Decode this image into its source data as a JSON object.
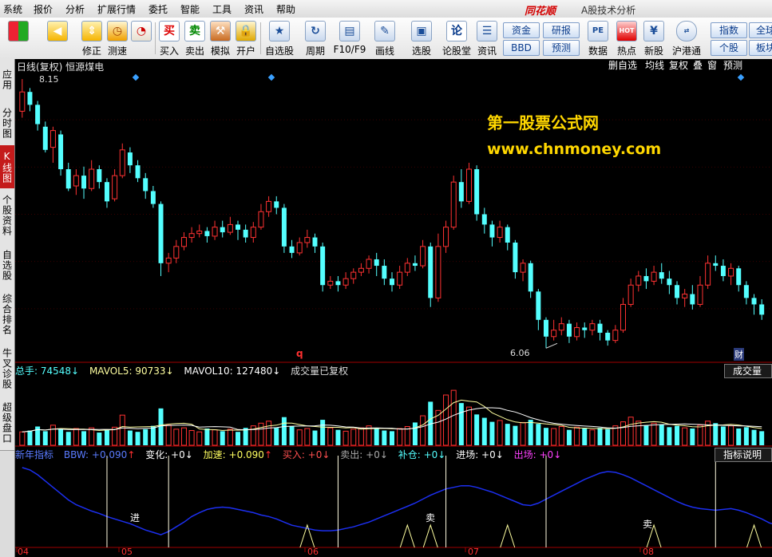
{
  "menu": {
    "items": [
      "系统",
      "报价",
      "分析",
      "扩展行情",
      "委托",
      "智能",
      "工具",
      "资讯",
      "帮助"
    ],
    "brand": "同花顺",
    "app_title": "A股技术分析"
  },
  "toolbar": {
    "buttons": [
      {
        "label": "",
        "icon": "windows-logo-icon"
      },
      {
        "label": "",
        "icon": "back-arrow-icon"
      },
      {
        "label": "修正",
        "icon": "up-down-arrow-icon"
      },
      {
        "label": "测速",
        "icon": "clock-icon"
      },
      {
        "label": "买入",
        "icon": "buy-icon",
        "glyph": "买"
      },
      {
        "label": "卖出",
        "icon": "sell-icon",
        "glyph": "卖"
      },
      {
        "label": "模拟",
        "icon": "gavel-icon"
      },
      {
        "label": "开户",
        "icon": "lock-icon"
      },
      {
        "label": "自选股",
        "icon": "star-icon"
      },
      {
        "label": "周期",
        "icon": "cycle-icon"
      },
      {
        "label": "F10/F9",
        "icon": "f10-icon"
      },
      {
        "label": "画线",
        "icon": "pen-icon"
      },
      {
        "label": "选股",
        "icon": "select-stock-icon"
      },
      {
        "label": "论股堂",
        "icon": "forum-icon",
        "glyph": "论"
      },
      {
        "label": "资讯",
        "icon": "news-icon"
      },
      {
        "label": "数据",
        "icon": "pe-icon",
        "glyph": "PE"
      },
      {
        "label": "热点",
        "icon": "hot-icon",
        "glyph": "HOT"
      },
      {
        "label": "新股",
        "icon": "ipo-icon"
      },
      {
        "label": "沪港通",
        "icon": "sse-hkex-icon"
      }
    ],
    "pills": [
      "资金",
      "研报",
      "BBD",
      "预测",
      "指数",
      "全球",
      "个股",
      "板块"
    ]
  },
  "left_tabs": [
    {
      "label": "应用",
      "active": false
    },
    {
      "label": "分时图",
      "active": false
    },
    {
      "label": "K线图",
      "active": true
    },
    {
      "label": "个股资料",
      "active": false
    },
    {
      "label": "自选股",
      "active": false
    },
    {
      "label": "综合排名",
      "active": false
    },
    {
      "label": "牛叉诊股",
      "active": false
    },
    {
      "label": "超级盘口",
      "active": false
    }
  ],
  "chart_header": {
    "stock": "日线(复权)  恒源煤电",
    "buttons": [
      "删自选",
      "均线",
      "复权",
      "叠",
      "窗",
      "预测"
    ]
  },
  "watermark": {
    "line1": "第一股票公式网",
    "line2": "www.chnmoney.com"
  },
  "price": {
    "high_label": "8.15",
    "low_label": "6.06",
    "event_q": "q",
    "event_cai": "财"
  },
  "volume_bar": {
    "total": "总手: 74548",
    "mavol5": "MAVOL5: 90733",
    "mavol10": "MAVOL10: 127480",
    "note": "成交量已复权",
    "button": "成交量"
  },
  "indicator_bar": {
    "name": "新年指标",
    "bbw": "BBW: +0.090",
    "change": "变化: +0",
    "accel": "加速: +0.090",
    "buy": "买入: +0",
    "sell": "卖出: +0",
    "add": "补仓: +0",
    "enter": "进场: +0",
    "exit": "出场: +0",
    "button": "指标说明",
    "signal_enter": "进",
    "signal_sell1": "卖",
    "signal_sell2": "卖"
  },
  "x_axis": [
    "04",
    "05",
    "06",
    "07",
    "08"
  ],
  "colors": {
    "up": "#ff3232",
    "down": "#54ffff",
    "ma5": "#ffffa0",
    "ma10": "#ffffff",
    "bbw_line": "#1c2ff0",
    "axis": "#a00000",
    "brand": "#d40000"
  },
  "chart_data": {
    "type": "candlestick",
    "price_range": [
      6.0,
      8.2
    ],
    "high": 8.15,
    "low": 6.06,
    "candles": [
      [
        7.9,
        8.05,
        8.15,
        7.85
      ],
      [
        8.05,
        7.95,
        8.08,
        7.9
      ],
      [
        7.95,
        7.8,
        7.98,
        7.75
      ],
      [
        7.78,
        7.6,
        7.82,
        7.58
      ],
      [
        7.62,
        7.75,
        7.78,
        7.5
      ],
      [
        7.72,
        7.45,
        7.75,
        7.4
      ],
      [
        7.45,
        7.3,
        7.5,
        7.28
      ],
      [
        7.32,
        7.4,
        7.45,
        7.25
      ],
      [
        7.4,
        7.3,
        7.47,
        7.22
      ],
      [
        7.3,
        7.45,
        7.52,
        7.28
      ],
      [
        7.45,
        7.35,
        7.48,
        7.3
      ],
      [
        7.35,
        7.2,
        7.38,
        7.15
      ],
      [
        7.22,
        7.4,
        7.45,
        7.2
      ],
      [
        7.4,
        7.6,
        7.65,
        7.38
      ],
      [
        7.58,
        7.48,
        7.62,
        7.42
      ],
      [
        7.48,
        7.38,
        7.52,
        7.35
      ],
      [
        7.38,
        7.28,
        7.42,
        7.22
      ],
      [
        7.28,
        7.18,
        7.32,
        7.15
      ],
      [
        7.18,
        6.72,
        7.2,
        6.62
      ],
      [
        6.72,
        6.76,
        6.8,
        6.65
      ],
      [
        6.76,
        6.85,
        6.9,
        6.72
      ],
      [
        6.85,
        6.92,
        6.96,
        6.82
      ],
      [
        6.92,
        6.95,
        7.0,
        6.88
      ],
      [
        6.95,
        6.97,
        7.02,
        6.92
      ],
      [
        6.97,
        6.93,
        7.0,
        6.88
      ],
      [
        6.93,
        7.0,
        7.05,
        6.9
      ],
      [
        7.0,
        6.96,
        7.05,
        6.92
      ],
      [
        6.96,
        7.02,
        7.08,
        6.94
      ],
      [
        7.02,
        6.98,
        7.05,
        6.9
      ],
      [
        6.98,
        6.92,
        7.02,
        6.88
      ],
      [
        6.92,
        7.0,
        7.04,
        6.88
      ],
      [
        7.0,
        7.12,
        7.18,
        6.98
      ],
      [
        7.12,
        7.2,
        7.24,
        7.08
      ],
      [
        7.2,
        7.15,
        7.24,
        7.1
      ],
      [
        7.15,
        6.85,
        7.18,
        6.8
      ],
      [
        6.85,
        6.8,
        6.9,
        6.76
      ],
      [
        6.8,
        6.88,
        6.92,
        6.78
      ],
      [
        6.88,
        6.92,
        6.98,
        6.84
      ],
      [
        6.92,
        6.85,
        6.95,
        6.8
      ],
      [
        6.85,
        6.55,
        6.88,
        6.5
      ],
      [
        6.55,
        6.58,
        6.62,
        6.52
      ],
      [
        6.58,
        6.55,
        6.62,
        6.5
      ],
      [
        6.55,
        6.6,
        6.65,
        6.52
      ],
      [
        6.6,
        6.65,
        6.68,
        6.56
      ],
      [
        6.65,
        6.68,
        6.72,
        6.62
      ],
      [
        6.68,
        6.75,
        6.78,
        6.64
      ],
      [
        6.75,
        6.7,
        6.8,
        6.62
      ],
      [
        6.7,
        6.6,
        6.75,
        6.55
      ],
      [
        6.6,
        6.55,
        6.65,
        6.5
      ],
      [
        6.55,
        6.65,
        6.7,
        6.52
      ],
      [
        6.65,
        6.72,
        6.76,
        6.62
      ],
      [
        6.72,
        6.7,
        6.78,
        6.66
      ],
      [
        6.7,
        6.85,
        6.9,
        6.68
      ],
      [
        6.85,
        6.45,
        6.88,
        6.38
      ],
      [
        6.45,
        6.85,
        6.95,
        6.42
      ],
      [
        6.85,
        7.0,
        7.05,
        6.8
      ],
      [
        7.0,
        7.35,
        7.4,
        6.98
      ],
      [
        7.35,
        7.2,
        7.45,
        7.15
      ],
      [
        7.2,
        7.45,
        7.5,
        7.18
      ],
      [
        7.45,
        7.1,
        7.48,
        7.05
      ],
      [
        7.1,
        7.02,
        7.15,
        6.95
      ],
      [
        7.02,
        6.92,
        7.05,
        6.85
      ],
      [
        6.92,
        7.0,
        7.05,
        6.88
      ],
      [
        7.0,
        6.88,
        7.02,
        6.82
      ],
      [
        6.88,
        6.65,
        6.9,
        6.6
      ],
      [
        6.65,
        6.72,
        6.75,
        6.58
      ],
      [
        6.72,
        6.5,
        6.74,
        6.45
      ],
      [
        6.5,
        6.28,
        6.52,
        6.2
      ],
      [
        6.28,
        6.15,
        6.3,
        6.06
      ],
      [
        6.15,
        6.2,
        6.28,
        6.12
      ],
      [
        6.2,
        6.25,
        6.3,
        6.16
      ],
      [
        6.25,
        6.15,
        6.28,
        6.1
      ],
      [
        6.15,
        6.22,
        6.26,
        6.12
      ],
      [
        6.22,
        6.2,
        6.26,
        6.14
      ],
      [
        6.2,
        6.25,
        6.28,
        6.16
      ],
      [
        6.25,
        6.18,
        6.28,
        6.12
      ],
      [
        6.18,
        6.12,
        6.2,
        6.08
      ],
      [
        6.12,
        6.2,
        6.24,
        6.1
      ],
      [
        6.2,
        6.4,
        6.45,
        6.18
      ],
      [
        6.4,
        6.55,
        6.6,
        6.38
      ],
      [
        6.55,
        6.62,
        6.66,
        6.5
      ],
      [
        6.62,
        6.58,
        6.68,
        6.52
      ],
      [
        6.58,
        6.65,
        6.7,
        6.55
      ],
      [
        6.65,
        6.6,
        6.72,
        6.56
      ],
      [
        6.6,
        6.55,
        6.66,
        6.48
      ],
      [
        6.55,
        6.45,
        6.58,
        6.4
      ],
      [
        6.45,
        6.48,
        6.52,
        6.38
      ],
      [
        6.48,
        6.4,
        6.55,
        6.36
      ],
      [
        6.4,
        6.55,
        6.62,
        6.38
      ],
      [
        6.55,
        6.72,
        6.78,
        6.52
      ],
      [
        6.72,
        6.7,
        6.78,
        6.66
      ],
      [
        6.7,
        6.62,
        6.75,
        6.58
      ],
      [
        6.62,
        6.68,
        6.72,
        6.55
      ],
      [
        6.68,
        6.55,
        6.7,
        6.5
      ],
      [
        6.55,
        6.45,
        6.58,
        6.4
      ],
      [
        6.45,
        6.4,
        6.48,
        6.32
      ],
      [
        6.4,
        6.32,
        6.44,
        6.28
      ]
    ],
    "volume": [
      2,
      2.2,
      2.8,
      2.1,
      3,
      2.4,
      2,
      2.5,
      2.1,
      2.6,
      1.9,
      2.3,
      2.7,
      4.5,
      2.2,
      2,
      2.4,
      2.9,
      5.5,
      3,
      2.4,
      2.6,
      2.2,
      2,
      2.5,
      2.3,
      2.1,
      2.4,
      2,
      2.6,
      2.9,
      3.3,
      3.6,
      2.6,
      4.2,
      2.8,
      2.3,
      2.5,
      2.2,
      3.8,
      2.6,
      2.3,
      2.1,
      2.4,
      2.6,
      2.9,
      2.5,
      2.2,
      2.1,
      2.5,
      2.8,
      3.4,
      4.4,
      6.5,
      5.2,
      7.5,
      8.2,
      6.3,
      5.7,
      4.6,
      4.1,
      3.5,
      3.7,
      3.2,
      2.9,
      3.4,
      3.8,
      3.2,
      2.6,
      2.5,
      2.8,
      2.3,
      2.7,
      2.5,
      2.3,
      2.6,
      2.4,
      2.9,
      3.5,
      4.2,
      3.6,
      3.0,
      3.3,
      3.1,
      2.7,
      2.9,
      2.6,
      2.5,
      3.0,
      3.6,
      3.3,
      2.8,
      2.9,
      2.5,
      2.7,
      2.3,
      2.1
    ],
    "volume_range": [
      0,
      10
    ],
    "bbw_line": [
      0.95,
      0.92,
      0.86,
      0.78,
      0.7,
      0.62,
      0.54,
      0.48,
      0.44,
      0.4,
      0.37,
      0.33,
      0.3,
      0.27,
      0.24,
      0.2,
      0.16,
      0.13,
      0.1,
      0.14,
      0.2,
      0.26,
      0.33,
      0.38,
      0.42,
      0.44,
      0.45,
      0.44,
      0.42,
      0.4,
      0.38,
      0.35,
      0.33,
      0.3,
      0.26,
      0.22,
      0.2,
      0.18,
      0.16,
      0.15,
      0.15,
      0.16,
      0.18,
      0.2,
      0.23,
      0.26,
      0.3,
      0.34,
      0.38,
      0.42,
      0.46,
      0.5,
      0.55,
      0.6,
      0.64,
      0.68,
      0.7,
      0.72,
      0.72,
      0.7,
      0.67,
      0.64,
      0.6,
      0.56,
      0.52,
      0.48,
      0.47,
      0.5,
      0.55,
      0.6,
      0.65,
      0.7,
      0.75,
      0.8,
      0.84,
      0.88,
      0.9,
      0.89,
      0.86,
      0.82,
      0.77,
      0.72,
      0.67,
      0.62,
      0.57,
      0.52,
      0.48,
      0.45,
      0.43,
      0.42,
      0.41,
      0.42,
      0.43,
      0.41,
      0.38,
      0.34,
      0.3,
      0.25,
      0.22
    ],
    "bbw_range": [
      0,
      1
    ],
    "buy_signals": [
      11,
      19,
      41,
      55,
      68,
      90,
      99
    ],
    "sell_signals": [
      37,
      50,
      53,
      63,
      82,
      95
    ]
  }
}
